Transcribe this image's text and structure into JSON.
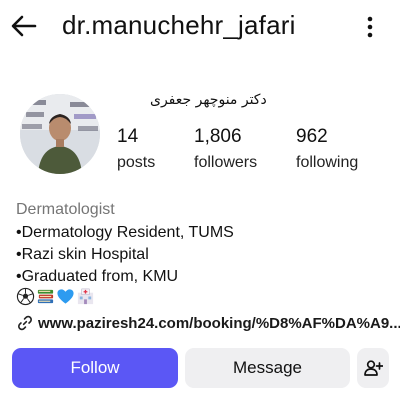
{
  "header": {
    "username": "dr.manuchehr_jafari",
    "back_icon": "arrow-left-icon",
    "menu_icon": "more-vertical-icon"
  },
  "profile": {
    "display_name": "دکتر منوچهر جعفری",
    "stats": [
      {
        "value": "14",
        "label": "posts"
      },
      {
        "value": "1,806",
        "label": "followers"
      },
      {
        "value": "962",
        "label": "following"
      }
    ],
    "category": "Dermatologist",
    "bio": [
      "•Dermatology Resident, TUMS",
      "•Razi skin Hospital",
      "•Graduated from, KMU"
    ],
    "emojis": [
      "soccer-ball-icon",
      "books-icon",
      "blue-heart-icon",
      "hospital-icon"
    ],
    "link": "www.paziresh24.com/booking/%D8%AF%DA%A9..."
  },
  "actions": {
    "follow_label": "Follow",
    "message_label": "Message",
    "add_user_icon": "person-add-icon"
  },
  "colors": {
    "follow_button": "#5b57f5",
    "secondary_button": "#efeff1",
    "category_text": "#757575"
  }
}
